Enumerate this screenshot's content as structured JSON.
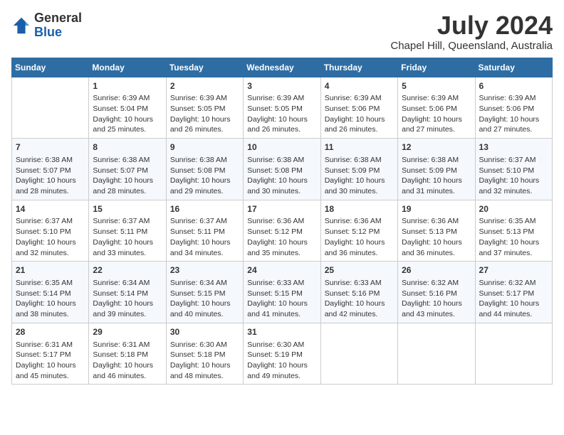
{
  "logo": {
    "general": "General",
    "blue": "Blue"
  },
  "title": "July 2024",
  "subtitle": "Chapel Hill, Queensland, Australia",
  "days_header": [
    "Sunday",
    "Monday",
    "Tuesday",
    "Wednesday",
    "Thursday",
    "Friday",
    "Saturday"
  ],
  "weeks": [
    [
      {
        "day": "",
        "info": ""
      },
      {
        "day": "1",
        "info": "Sunrise: 6:39 AM\nSunset: 5:04 PM\nDaylight: 10 hours\nand 25 minutes."
      },
      {
        "day": "2",
        "info": "Sunrise: 6:39 AM\nSunset: 5:05 PM\nDaylight: 10 hours\nand 26 minutes."
      },
      {
        "day": "3",
        "info": "Sunrise: 6:39 AM\nSunset: 5:05 PM\nDaylight: 10 hours\nand 26 minutes."
      },
      {
        "day": "4",
        "info": "Sunrise: 6:39 AM\nSunset: 5:06 PM\nDaylight: 10 hours\nand 26 minutes."
      },
      {
        "day": "5",
        "info": "Sunrise: 6:39 AM\nSunset: 5:06 PM\nDaylight: 10 hours\nand 27 minutes."
      },
      {
        "day": "6",
        "info": "Sunrise: 6:39 AM\nSunset: 5:06 PM\nDaylight: 10 hours\nand 27 minutes."
      }
    ],
    [
      {
        "day": "7",
        "info": "Sunrise: 6:38 AM\nSunset: 5:07 PM\nDaylight: 10 hours\nand 28 minutes."
      },
      {
        "day": "8",
        "info": "Sunrise: 6:38 AM\nSunset: 5:07 PM\nDaylight: 10 hours\nand 28 minutes."
      },
      {
        "day": "9",
        "info": "Sunrise: 6:38 AM\nSunset: 5:08 PM\nDaylight: 10 hours\nand 29 minutes."
      },
      {
        "day": "10",
        "info": "Sunrise: 6:38 AM\nSunset: 5:08 PM\nDaylight: 10 hours\nand 30 minutes."
      },
      {
        "day": "11",
        "info": "Sunrise: 6:38 AM\nSunset: 5:09 PM\nDaylight: 10 hours\nand 30 minutes."
      },
      {
        "day": "12",
        "info": "Sunrise: 6:38 AM\nSunset: 5:09 PM\nDaylight: 10 hours\nand 31 minutes."
      },
      {
        "day": "13",
        "info": "Sunrise: 6:37 AM\nSunset: 5:10 PM\nDaylight: 10 hours\nand 32 minutes."
      }
    ],
    [
      {
        "day": "14",
        "info": "Sunrise: 6:37 AM\nSunset: 5:10 PM\nDaylight: 10 hours\nand 32 minutes."
      },
      {
        "day": "15",
        "info": "Sunrise: 6:37 AM\nSunset: 5:11 PM\nDaylight: 10 hours\nand 33 minutes."
      },
      {
        "day": "16",
        "info": "Sunrise: 6:37 AM\nSunset: 5:11 PM\nDaylight: 10 hours\nand 34 minutes."
      },
      {
        "day": "17",
        "info": "Sunrise: 6:36 AM\nSunset: 5:12 PM\nDaylight: 10 hours\nand 35 minutes."
      },
      {
        "day": "18",
        "info": "Sunrise: 6:36 AM\nSunset: 5:12 PM\nDaylight: 10 hours\nand 36 minutes."
      },
      {
        "day": "19",
        "info": "Sunrise: 6:36 AM\nSunset: 5:13 PM\nDaylight: 10 hours\nand 36 minutes."
      },
      {
        "day": "20",
        "info": "Sunrise: 6:35 AM\nSunset: 5:13 PM\nDaylight: 10 hours\nand 37 minutes."
      }
    ],
    [
      {
        "day": "21",
        "info": "Sunrise: 6:35 AM\nSunset: 5:14 PM\nDaylight: 10 hours\nand 38 minutes."
      },
      {
        "day": "22",
        "info": "Sunrise: 6:34 AM\nSunset: 5:14 PM\nDaylight: 10 hours\nand 39 minutes."
      },
      {
        "day": "23",
        "info": "Sunrise: 6:34 AM\nSunset: 5:15 PM\nDaylight: 10 hours\nand 40 minutes."
      },
      {
        "day": "24",
        "info": "Sunrise: 6:33 AM\nSunset: 5:15 PM\nDaylight: 10 hours\nand 41 minutes."
      },
      {
        "day": "25",
        "info": "Sunrise: 6:33 AM\nSunset: 5:16 PM\nDaylight: 10 hours\nand 42 minutes."
      },
      {
        "day": "26",
        "info": "Sunrise: 6:32 AM\nSunset: 5:16 PM\nDaylight: 10 hours\nand 43 minutes."
      },
      {
        "day": "27",
        "info": "Sunrise: 6:32 AM\nSunset: 5:17 PM\nDaylight: 10 hours\nand 44 minutes."
      }
    ],
    [
      {
        "day": "28",
        "info": "Sunrise: 6:31 AM\nSunset: 5:17 PM\nDaylight: 10 hours\nand 45 minutes."
      },
      {
        "day": "29",
        "info": "Sunrise: 6:31 AM\nSunset: 5:18 PM\nDaylight: 10 hours\nand 46 minutes."
      },
      {
        "day": "30",
        "info": "Sunrise: 6:30 AM\nSunset: 5:18 PM\nDaylight: 10 hours\nand 48 minutes."
      },
      {
        "day": "31",
        "info": "Sunrise: 6:30 AM\nSunset: 5:19 PM\nDaylight: 10 hours\nand 49 minutes."
      },
      {
        "day": "",
        "info": ""
      },
      {
        "day": "",
        "info": ""
      },
      {
        "day": "",
        "info": ""
      }
    ]
  ]
}
